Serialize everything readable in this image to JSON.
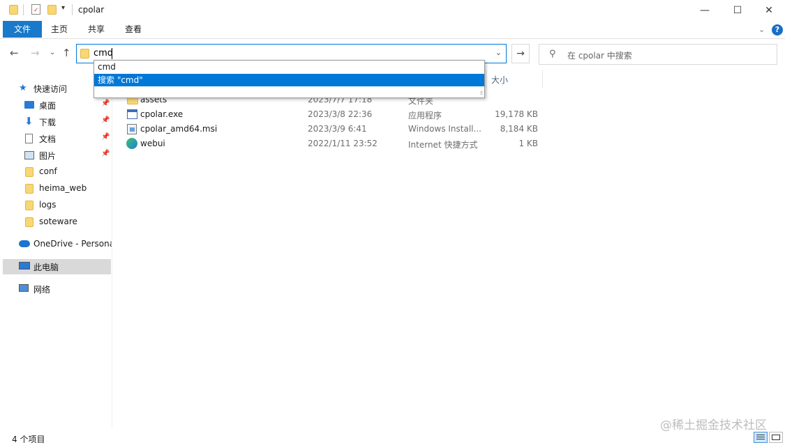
{
  "window": {
    "title": "cpolar"
  },
  "ribbon": {
    "tabs": [
      "文件",
      "主页",
      "共享",
      "查看"
    ]
  },
  "address": {
    "value": "cmd"
  },
  "search": {
    "placeholder": "在 cpolar 中搜索"
  },
  "autocomplete": {
    "items": [
      "cmd",
      "搜索 \"cmd\""
    ],
    "selected_index": 1
  },
  "columns": {
    "size": "大小"
  },
  "sidebar": {
    "quick_access": "快速访问",
    "items": [
      {
        "label": "桌面",
        "icon": "desktop-icon",
        "pinned": true
      },
      {
        "label": "下载",
        "icon": "download-icon",
        "pinned": true
      },
      {
        "label": "文档",
        "icon": "document-icon",
        "pinned": true
      },
      {
        "label": "图片",
        "icon": "pictures-icon",
        "pinned": true
      },
      {
        "label": "conf",
        "icon": "folder-icon",
        "pinned": false
      },
      {
        "label": "heima_web",
        "icon": "folder-icon",
        "pinned": false
      },
      {
        "label": "logs",
        "icon": "folder-icon",
        "pinned": false
      },
      {
        "label": "soteware",
        "icon": "folder-icon",
        "pinned": false
      }
    ],
    "onedrive": "OneDrive - Persona",
    "this_pc": "此电脑",
    "network": "网络"
  },
  "files": [
    {
      "name": "assets",
      "date": "2023/7/7 17:18",
      "type": "文件夹",
      "size": "",
      "icon": "folder-icon"
    },
    {
      "name": "cpolar.exe",
      "date": "2023/3/8 22:36",
      "type": "应用程序",
      "size": "19,178 KB",
      "icon": "exe-icon"
    },
    {
      "name": "cpolar_amd64.msi",
      "date": "2023/3/9 6:41",
      "type": "Windows Install...",
      "size": "8,184 KB",
      "icon": "msi-icon"
    },
    {
      "name": "webui",
      "date": "2022/1/11 23:52",
      "type": "Internet 快捷方式",
      "size": "1 KB",
      "icon": "edge-icon"
    }
  ],
  "status": {
    "item_count": "4 个项目"
  },
  "watermark": "@稀土掘金技术社区",
  "colors": {
    "accent": "#0078d7",
    "file_tab": "#1979ca",
    "selection": "#cce8ff",
    "folder": "#f8d775"
  }
}
